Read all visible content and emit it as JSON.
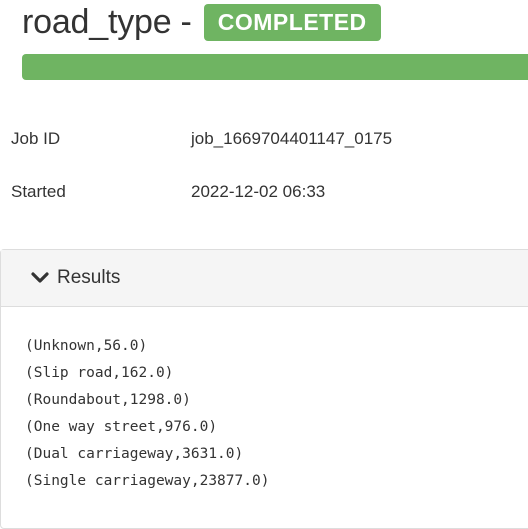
{
  "job": {
    "name": "road_type",
    "separator": "-",
    "status": "COMPLETED",
    "progress_fraction": 1.0
  },
  "info": {
    "job_id_label": "Job ID",
    "job_id_value": "job_1669704401147_0175",
    "started_label": "Started",
    "started_value": "2022-12-02 06:33"
  },
  "results": {
    "heading": "Results",
    "toggle_icon": "chevron-down-icon",
    "lines": [
      "(Unknown,56.0)",
      "(Slip road,162.0)",
      "(Roundabout,1298.0)",
      "(One way street,976.0)",
      "(Dual carriageway,3631.0)",
      "(Single carriageway,23877.0)"
    ]
  },
  "colors": {
    "success": "#6fb462",
    "panel_heading_bg": "#f5f5f5",
    "text": "#333333"
  }
}
